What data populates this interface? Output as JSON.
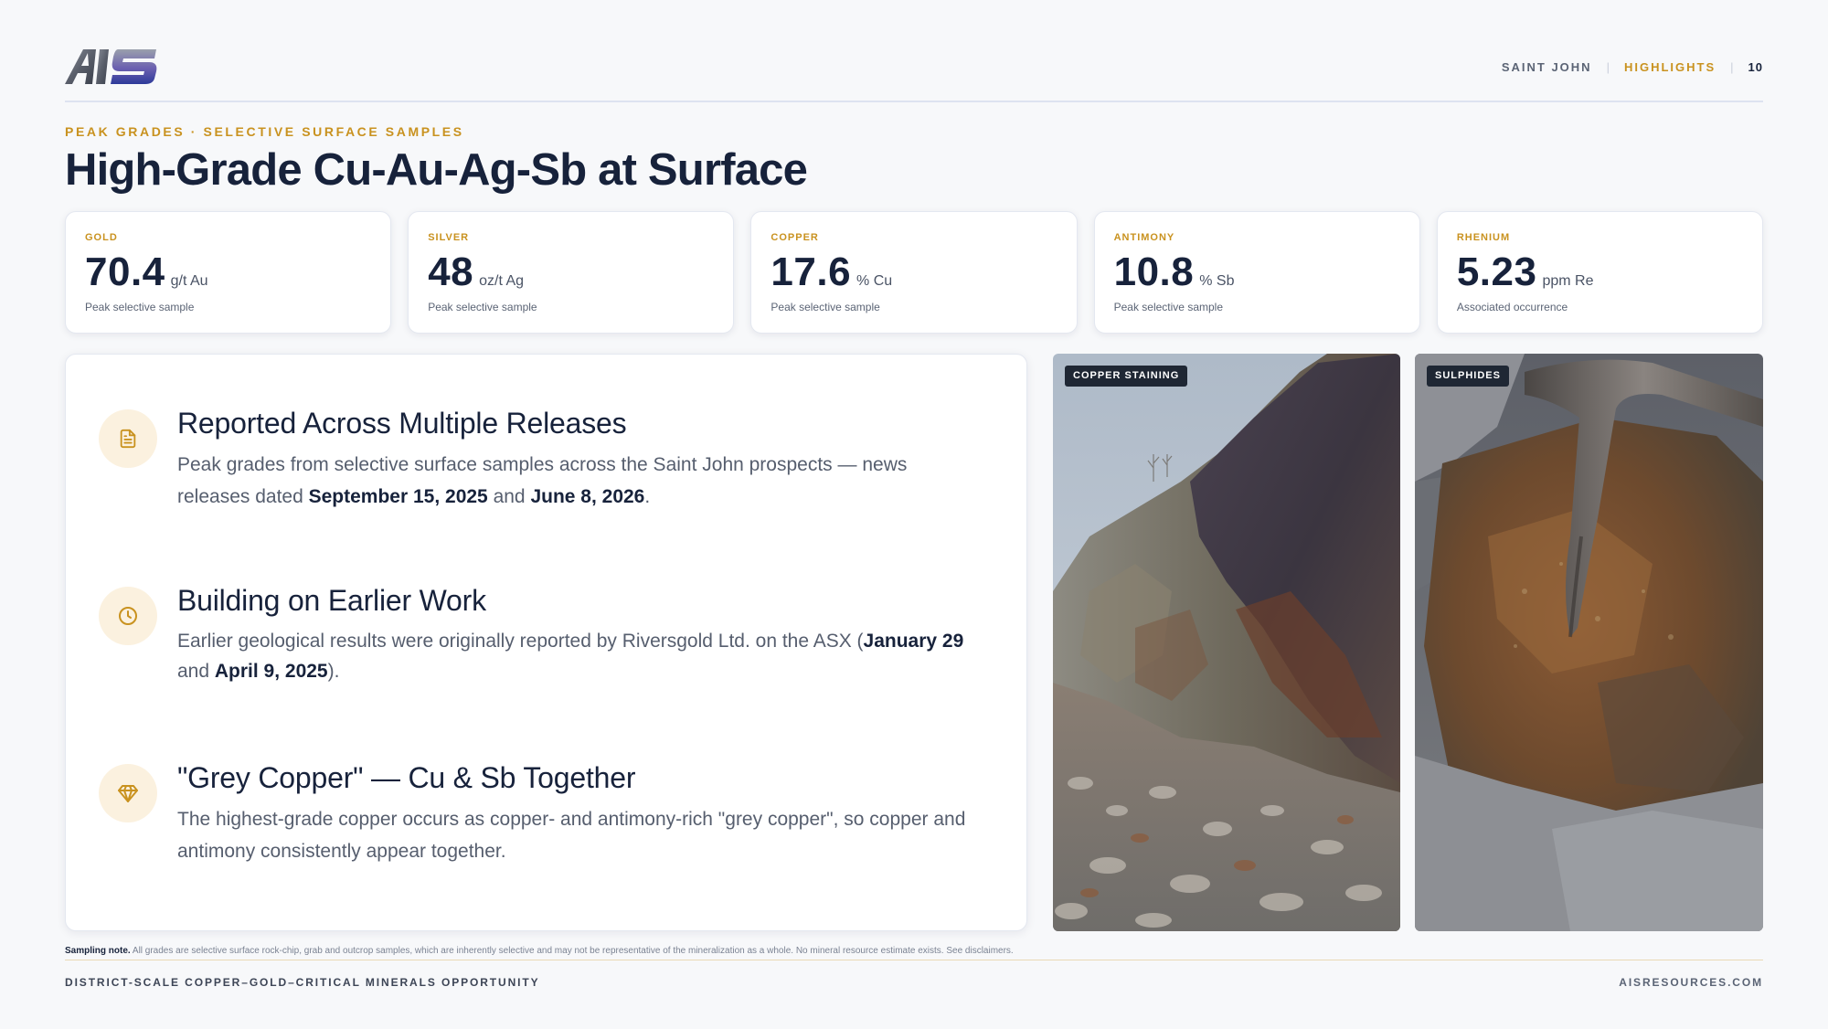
{
  "header": {
    "logo_text": "AIS",
    "location": "SAINT JOHN",
    "section": "HIGHLIGHTS",
    "page": "10"
  },
  "eyebrow": "PEAK GRADES · SELECTIVE SURFACE SAMPLES",
  "title": "High-Grade Cu-Au-Ag-Sb at Surface",
  "stats": [
    {
      "label": "GOLD",
      "value": "70.4",
      "unit": "g/t Au",
      "note": "Peak selective sample"
    },
    {
      "label": "SILVER",
      "value": "48",
      "unit": "oz/t Ag",
      "note": "Peak selective sample"
    },
    {
      "label": "COPPER",
      "value": "17.6",
      "unit": "% Cu",
      "note": "Peak selective sample"
    },
    {
      "label": "ANTIMONY",
      "value": "10.8",
      "unit": "% Sb",
      "note": "Peak selective sample"
    },
    {
      "label": "RHENIUM",
      "value": "5.23",
      "unit": "ppm Re",
      "note": "Associated occurrence"
    }
  ],
  "items": [
    {
      "icon": "document-icon",
      "title": "Reported Across Multiple Releases",
      "text_a": "Peak grades from selective surface samples across the Saint John prospects — news releases dated ",
      "bold_1": "September 15, 2025",
      "text_b": " and ",
      "bold_2": "June 8, 2026",
      "text_c": "."
    },
    {
      "icon": "clock-icon",
      "title": "Building on Earlier Work",
      "text_a": "Earlier geological results were originally reported by Riversgold Ltd. on the ASX (",
      "bold_1": "January 29",
      "text_b": " and ",
      "bold_2": "April 9, 2025",
      "text_c": ")."
    },
    {
      "icon": "gem-icon",
      "title": "\"Grey Copper\" — Cu & Sb Together",
      "text_a": "The highest-grade copper occurs as copper- and antimony-rich \"grey copper\", so copper and antimony consistently appear together."
    }
  ],
  "photos": [
    {
      "tag": "COPPER STAINING"
    },
    {
      "tag": "SULPHIDES"
    }
  ],
  "footer": {
    "sampling_label": "Sampling note.",
    "sampling_text": " All grades are selective surface rock-chip, grab and outcrop samples, which are inherently selective and may not be representative of the mineralization as a whole. No mineral resource estimate exists. See disclaimers.",
    "left": "DISTRICT-SCALE COPPER–GOLD–CRITICAL MINERALS OPPORTUNITY",
    "right": "AISRESOURCES.COM"
  },
  "colors": {
    "accent": "#c9921f",
    "navy": "#17223b",
    "icon_bg": "#fbf1df"
  }
}
